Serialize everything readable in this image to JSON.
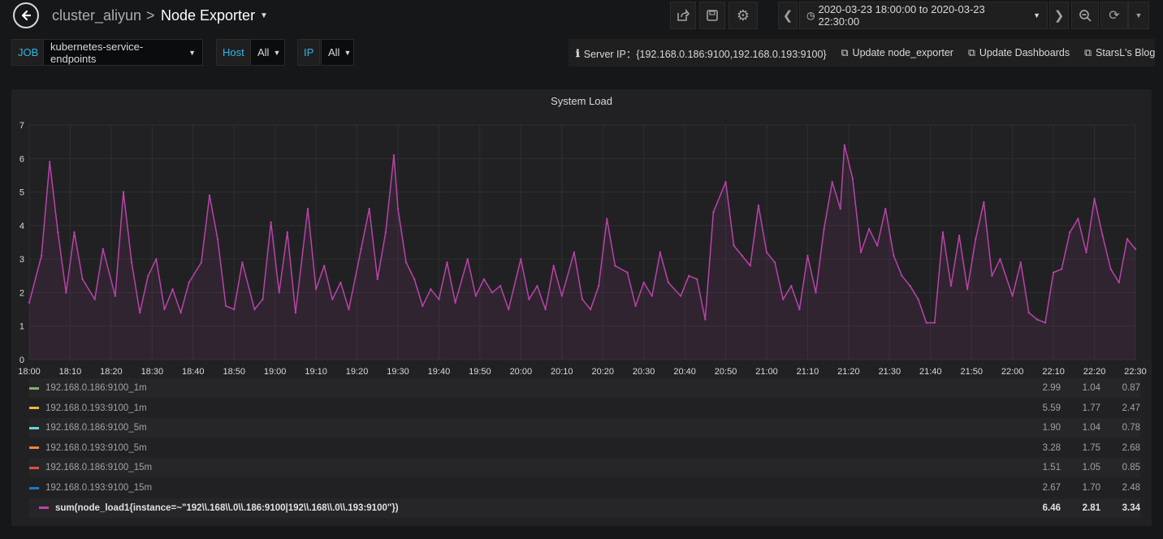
{
  "nav": {
    "breadcrumb_folder": "cluster_aliyun",
    "breadcrumb_separator": ">",
    "dashboard_title": "Node Exporter",
    "time_range": "2020-03-23 18:00:00 to 2020-03-23 22:30:00"
  },
  "variables": [
    {
      "label": "JOB",
      "value": "kubernetes-service-endpoints"
    },
    {
      "label": "Host",
      "value": "All"
    },
    {
      "label": "IP",
      "value": "All"
    }
  ],
  "links": {
    "server_ip": "Server IP：{192.168.0.186:9100,192.168.0.193:9100}",
    "update_node_exporter": "Update node_exporter",
    "update_dashboards": "Update Dashboards",
    "blog": "StarsL's Blog"
  },
  "panel": {
    "title": "System Load"
  },
  "colors": {
    "accent": "#33b5e5",
    "series": "#ba43a9"
  },
  "chart_data": {
    "type": "line",
    "title": "System Load",
    "ylim": [
      0,
      7
    ],
    "yticks": [
      "0",
      "1",
      "2",
      "3",
      "4",
      "5",
      "6",
      "7"
    ],
    "xticks": [
      "18:00",
      "18:10",
      "18:20",
      "18:30",
      "18:40",
      "18:50",
      "19:00",
      "19:10",
      "19:20",
      "19:30",
      "19:40",
      "19:50",
      "20:00",
      "20:10",
      "20:20",
      "20:30",
      "20:40",
      "20:50",
      "21:00",
      "21:10",
      "21:20",
      "21:30",
      "21:40",
      "21:50",
      "22:00",
      "22:10",
      "22:20",
      "22:30"
    ],
    "grid": true,
    "series": [
      {
        "name": "sum(node_load1{instance=~\"192\\\\.168\\\\.0\\\\.186:9100|192\\\\.168\\\\.0\\\\.193:9100\"})",
        "color": "#ba43a9",
        "x": [
          "18:00",
          "18:03",
          "18:05",
          "18:07",
          "18:09",
          "18:11",
          "18:13",
          "18:16",
          "18:18",
          "18:21",
          "18:23",
          "18:25",
          "18:27",
          "18:29",
          "18:31",
          "18:33",
          "18:35",
          "18:37",
          "18:39",
          "18:42",
          "18:44",
          "18:46",
          "18:48",
          "18:50",
          "18:52",
          "18:55",
          "18:57",
          "18:59",
          "19:01",
          "19:03",
          "19:05",
          "19:08",
          "19:10",
          "19:12",
          "19:14",
          "19:16",
          "19:18",
          "19:21",
          "19:23",
          "19:25",
          "19:27",
          "19:29",
          "19:30",
          "19:32",
          "19:34",
          "19:36",
          "19:38",
          "19:40",
          "19:42",
          "19:44",
          "19:47",
          "19:49",
          "19:51",
          "19:53",
          "19:55",
          "19:57",
          "20:00",
          "20:02",
          "20:04",
          "20:06",
          "20:08",
          "20:10",
          "20:13",
          "20:15",
          "20:17",
          "20:19",
          "20:21",
          "20:23",
          "20:26",
          "20:28",
          "20:30",
          "20:32",
          "20:34",
          "20:36",
          "20:39",
          "20:41",
          "20:43",
          "20:45",
          "20:47",
          "20:50",
          "20:52",
          "20:54",
          "20:56",
          "20:58",
          "21:00",
          "21:02",
          "21:04",
          "21:06",
          "21:08",
          "21:10",
          "21:12",
          "21:14",
          "21:16",
          "21:18",
          "21:19",
          "21:21",
          "21:23",
          "21:25",
          "21:27",
          "21:29",
          "21:31",
          "21:33",
          "21:35",
          "21:37",
          "21:39",
          "21:41",
          "21:43",
          "21:45",
          "21:47",
          "21:49",
          "21:51",
          "21:53",
          "21:55",
          "21:57",
          "22:00",
          "22:02",
          "22:04",
          "22:06",
          "22:08",
          "22:10",
          "22:12",
          "22:14",
          "22:16",
          "22:18",
          "22:20",
          "22:22",
          "22:24",
          "22:26",
          "22:28",
          "22:30"
        ],
        "values": [
          1.7,
          3.1,
          5.9,
          3.8,
          2.0,
          3.8,
          2.4,
          1.8,
          3.3,
          1.9,
          5.0,
          2.9,
          1.4,
          2.5,
          3.0,
          1.5,
          2.1,
          1.4,
          2.3,
          2.9,
          4.9,
          3.6,
          1.6,
          1.5,
          2.9,
          1.5,
          1.8,
          4.1,
          2.0,
          3.8,
          1.4,
          4.5,
          2.1,
          2.8,
          1.8,
          2.3,
          1.5,
          3.3,
          4.5,
          2.4,
          3.8,
          6.1,
          4.5,
          2.9,
          2.4,
          1.6,
          2.1,
          1.8,
          2.9,
          1.7,
          3.0,
          1.9,
          2.4,
          2.0,
          2.2,
          1.5,
          3.0,
          1.8,
          2.2,
          1.5,
          2.8,
          1.9,
          3.2,
          1.8,
          1.5,
          2.2,
          4.2,
          2.8,
          2.6,
          1.6,
          2.3,
          1.9,
          3.2,
          2.3,
          1.9,
          2.5,
          2.4,
          1.2,
          4.4,
          5.3,
          3.4,
          3.1,
          2.8,
          4.6,
          3.2,
          2.9,
          1.8,
          2.2,
          1.5,
          3.1,
          2.0,
          3.9,
          5.3,
          4.5,
          6.4,
          5.4,
          3.2,
          3.9,
          3.4,
          4.5,
          3.1,
          2.5,
          2.2,
          1.8,
          1.1,
          1.1,
          3.8,
          2.2,
          3.7,
          2.1,
          3.6,
          4.7,
          2.5,
          3.0,
          1.9,
          2.9,
          1.4,
          1.2,
          1.1,
          2.6,
          2.7,
          3.8,
          4.2,
          3.2,
          4.8,
          3.7,
          2.7,
          2.3,
          3.6,
          3.3
        ]
      }
    ]
  },
  "legend": {
    "rows": [
      {
        "name": "192.168.0.186:9100_1m",
        "color": "#7eb26d",
        "v1": "2.99",
        "v2": "1.04",
        "v3": "0.87"
      },
      {
        "name": "192.168.0.193:9100_1m",
        "color": "#eab839",
        "v1": "5.59",
        "v2": "1.77",
        "v3": "2.47"
      },
      {
        "name": "192.168.0.186:9100_5m",
        "color": "#6ed0e0",
        "v1": "1.90",
        "v2": "1.04",
        "v3": "0.78"
      },
      {
        "name": "192.168.0.193:9100_5m",
        "color": "#ef843c",
        "v1": "3.28",
        "v2": "1.75",
        "v3": "2.68"
      },
      {
        "name": "192.168.0.186:9100_15m",
        "color": "#e24d42",
        "v1": "1.51",
        "v2": "1.05",
        "v3": "0.85"
      },
      {
        "name": "192.168.0.193:9100_15m",
        "color": "#1f78c1",
        "v1": "2.67",
        "v2": "1.70",
        "v3": "2.48"
      }
    ],
    "sum_row": {
      "name": "sum(node_load1{instance=~\"192\\\\.168\\\\.0\\\\.186:9100|192\\\\.168\\\\.0\\\\.193:9100\"})",
      "v1": "6.46",
      "v2": "2.81",
      "v3": "3.34"
    }
  }
}
